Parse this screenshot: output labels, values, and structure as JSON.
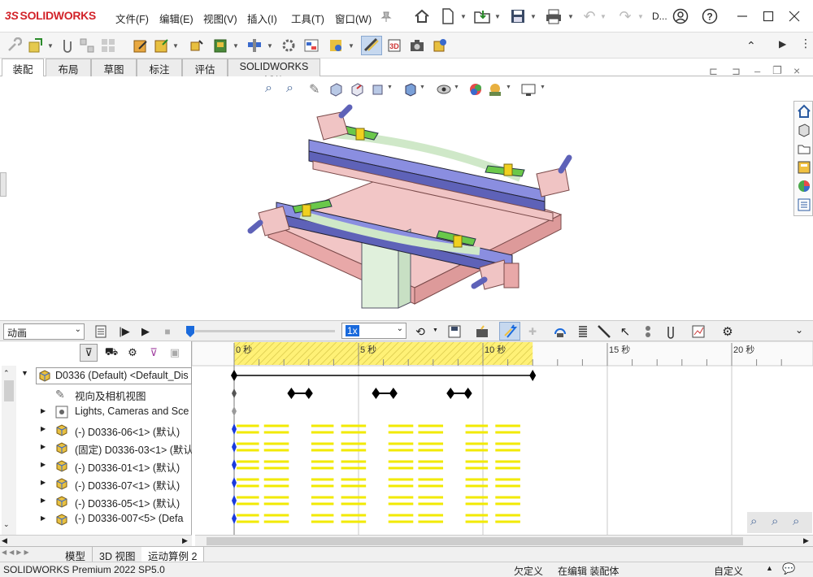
{
  "app": {
    "logo_mark": "3S",
    "logo_text": "SOLIDWORKS"
  },
  "menu": {
    "items": [
      "文件(F)",
      "编辑(E)",
      "视图(V)",
      "插入(I)",
      "工具(T)",
      "窗口(W)"
    ],
    "user_label": "D..."
  },
  "tabs": [
    "装配体",
    "布局",
    "草图",
    "标注",
    "评估",
    "SOLIDWORKS 插件"
  ],
  "animation": {
    "study_type": "动画",
    "playback_speed": "1x"
  },
  "timeline": {
    "ticks": [
      "0 秒",
      "5 秒",
      "10 秒",
      "15 秒",
      "20 秒"
    ],
    "tick_seconds": [
      0,
      5,
      10,
      15,
      20
    ],
    "highlight_end_seconds": 12
  },
  "tree": {
    "rows": [
      {
        "label": "D0336 (Default) <Default_Dis",
        "icon": "assembly-icon"
      },
      {
        "label": "视向及相机视图",
        "icon": "camera-icon"
      },
      {
        "label": "Lights, Cameras and Sce",
        "icon": "lights-icon"
      },
      {
        "label": "(-) D0336-06<1> (默认)",
        "icon": "part-icon"
      },
      {
        "label": "(固定) D0336-03<1> (默认",
        "icon": "part-icon"
      },
      {
        "label": "(-) D0336-01<1> (默认)",
        "icon": "part-icon"
      },
      {
        "label": "(-) D0336-07<1> (默认)",
        "icon": "part-icon"
      },
      {
        "label": "(-) D0336-05<1> (默认)",
        "icon": "part-icon"
      },
      {
        "label": "(-) D0336-007<5> (Defa",
        "icon": "part-icon"
      }
    ]
  },
  "bottom_tabs": [
    "模型",
    "3D 视图",
    "运动算例 2"
  ],
  "status": {
    "left": "SOLIDWORKS Premium 2022 SP5.0",
    "under": "欠定义",
    "mode": "在编辑 装配体",
    "custom": "自定义"
  },
  "colors": {
    "accent": "#d2232a",
    "timeline_highlight": "#fff176",
    "key_bar": "#f2ea00",
    "assembly_blue": "#7b7fd6",
    "assembly_pink": "#f2c6c6"
  }
}
